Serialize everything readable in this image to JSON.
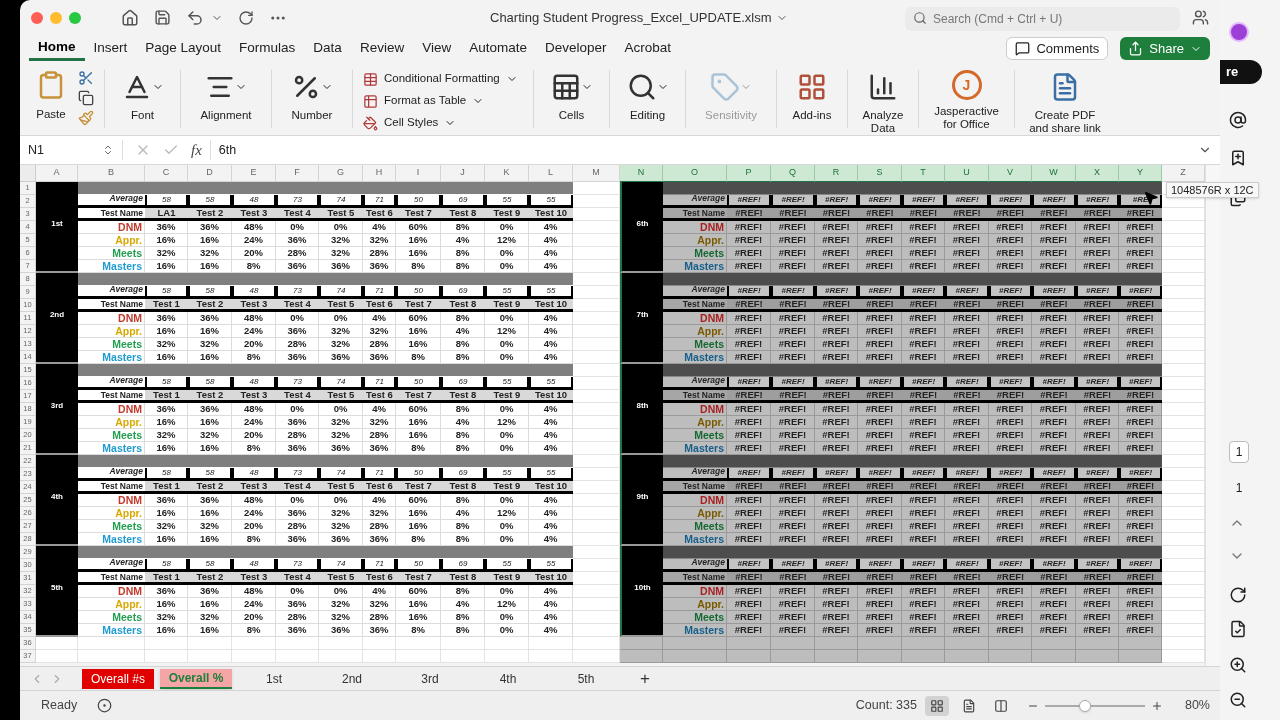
{
  "window": {
    "title": "Charting Student Progress_Excel_UPDATE.xlsm",
    "search_placeholder": "Search (Cmd + Ctrl + U)"
  },
  "tabs": [
    {
      "label": "Home",
      "selected": true
    },
    {
      "label": "Insert",
      "selected": false
    },
    {
      "label": "Page Layout",
      "selected": false
    },
    {
      "label": "Formulas",
      "selected": false
    },
    {
      "label": "Data",
      "selected": false
    },
    {
      "label": "Review",
      "selected": false
    },
    {
      "label": "View",
      "selected": false
    },
    {
      "label": "Automate",
      "selected": false
    },
    {
      "label": "Developer",
      "selected": false
    },
    {
      "label": "Acrobat",
      "selected": false
    }
  ],
  "comments_button": "Comments",
  "share_button": "Share",
  "ribbon": [
    {
      "kind": "paste",
      "label": "Paste",
      "disabled": false
    },
    {
      "kind": "font",
      "label": "Font",
      "disabled": false
    },
    {
      "kind": "alignment",
      "label": "Alignment",
      "disabled": false
    },
    {
      "kind": "number",
      "label": "Number",
      "disabled": false
    },
    {
      "kind": "styles",
      "items": [
        "Conditional Formatting",
        "Format as Table",
        "Cell Styles"
      ],
      "disabled": false
    },
    {
      "kind": "cells",
      "label": "Cells",
      "disabled": false
    },
    {
      "kind": "editing",
      "label": "Editing",
      "disabled": false
    },
    {
      "kind": "sensitivity",
      "label": "Sensitivity",
      "disabled": true
    },
    {
      "kind": "addins",
      "label": "Add-ins",
      "disabled": false
    },
    {
      "kind": "analyze",
      "label": "Analyze Data",
      "disabled": false
    },
    {
      "kind": "jasper",
      "label": "Jasperactive for Office",
      "logo": "J",
      "disabled": false
    },
    {
      "kind": "pdf",
      "label": "Create PDF and share link",
      "disabled": false
    }
  ],
  "formula_bar": {
    "name_box": "N1",
    "fx": "fx",
    "value": "6th"
  },
  "columns": [
    {
      "label": "A",
      "selected": false
    },
    {
      "label": "B",
      "selected": false
    },
    {
      "label": "C",
      "selected": false
    },
    {
      "label": "D",
      "selected": false
    },
    {
      "label": "E",
      "selected": false
    },
    {
      "label": "F",
      "selected": false
    },
    {
      "label": "G",
      "selected": false
    },
    {
      "label": "H",
      "selected": false
    },
    {
      "label": "I",
      "selected": false
    },
    {
      "label": "J",
      "selected": false
    },
    {
      "label": "K",
      "selected": false
    },
    {
      "label": "L",
      "selected": false
    },
    {
      "label": "M",
      "selected": false
    },
    {
      "label": "N",
      "selected": true
    },
    {
      "label": "O",
      "selected": true
    },
    {
      "label": "P",
      "selected": true
    },
    {
      "label": "Q",
      "selected": true
    },
    {
      "label": "R",
      "selected": true
    },
    {
      "label": "S",
      "selected": true
    },
    {
      "label": "T",
      "selected": true
    },
    {
      "label": "U",
      "selected": true
    },
    {
      "label": "V",
      "selected": true
    },
    {
      "label": "W",
      "selected": true
    },
    {
      "label": "X",
      "selected": true
    },
    {
      "label": "Y",
      "selected": true
    },
    {
      "label": "Z",
      "selected": false
    }
  ],
  "rows": [
    "1",
    "2",
    "3",
    "4",
    "5",
    "6",
    "7",
    "8",
    "9",
    "10",
    "11",
    "12",
    "13",
    "14",
    "15",
    "16",
    "17",
    "18",
    "19",
    "20",
    "21",
    "22",
    "23",
    "24",
    "25",
    "26",
    "27",
    "28",
    "29",
    "30",
    "31",
    "32",
    "33",
    "34",
    "35",
    "36",
    "37"
  ],
  "blocks": [
    {
      "label": "1st",
      "selected": false,
      "average_label": "Average",
      "test_label": "Test Name",
      "averages": [
        "58",
        "58",
        "48",
        "73",
        "74",
        "71",
        "50",
        "69",
        "55",
        "55"
      ],
      "tests": [
        "LA1",
        "Test 2",
        "Test 3",
        "Test 4",
        "Test 5",
        "Test 6",
        "Test 7",
        "Test 8",
        "Test 9",
        "Test 10"
      ],
      "categories": [
        {
          "name": "DNM",
          "color": "#c0392b",
          "values": [
            "36%",
            "36%",
            "48%",
            "0%",
            "0%",
            "4%",
            "60%",
            "8%",
            "0%",
            "4%"
          ]
        },
        {
          "name": "Appr.",
          "color": "#d9a800",
          "values": [
            "16%",
            "16%",
            "24%",
            "36%",
            "32%",
            "32%",
            "16%",
            "4%",
            "12%",
            "4%"
          ]
        },
        {
          "name": "Meets",
          "color": "#22a050",
          "values": [
            "32%",
            "32%",
            "20%",
            "28%",
            "32%",
            "28%",
            "16%",
            "8%",
            "0%",
            "4%"
          ]
        },
        {
          "name": "Masters",
          "color": "#1f9bd0",
          "values": [
            "16%",
            "16%",
            "8%",
            "36%",
            "36%",
            "36%",
            "8%",
            "8%",
            "0%",
            "4%"
          ]
        }
      ]
    },
    {
      "label": "2nd",
      "selected": false,
      "average_label": "Average",
      "test_label": "Test Name",
      "averages": [
        "58",
        "58",
        "48",
        "73",
        "74",
        "71",
        "50",
        "69",
        "55",
        "55"
      ],
      "tests": [
        "Test 1",
        "Test 2",
        "Test 3",
        "Test 4",
        "Test 5",
        "Test 6",
        "Test 7",
        "Test 8",
        "Test 9",
        "Test 10"
      ],
      "categories": [
        {
          "name": "DNM",
          "color": "#c0392b",
          "values": [
            "36%",
            "36%",
            "48%",
            "0%",
            "0%",
            "4%",
            "60%",
            "8%",
            "0%",
            "4%"
          ]
        },
        {
          "name": "Appr.",
          "color": "#d9a800",
          "values": [
            "16%",
            "16%",
            "24%",
            "36%",
            "32%",
            "32%",
            "16%",
            "4%",
            "12%",
            "4%"
          ]
        },
        {
          "name": "Meets",
          "color": "#22a050",
          "values": [
            "32%",
            "32%",
            "20%",
            "28%",
            "32%",
            "28%",
            "16%",
            "8%",
            "0%",
            "4%"
          ]
        },
        {
          "name": "Masters",
          "color": "#1f9bd0",
          "values": [
            "16%",
            "16%",
            "8%",
            "36%",
            "36%",
            "36%",
            "8%",
            "8%",
            "0%",
            "4%"
          ]
        }
      ]
    },
    {
      "label": "3rd",
      "selected": false,
      "average_label": "Average",
      "test_label": "Test Name",
      "averages": [
        "58",
        "58",
        "48",
        "73",
        "74",
        "71",
        "50",
        "69",
        "55",
        "55"
      ],
      "tests": [
        "Test 1",
        "Test 2",
        "Test 3",
        "Test 4",
        "Test 5",
        "Test 6",
        "Test 7",
        "Test 8",
        "Test 9",
        "Test 10"
      ],
      "categories": [
        {
          "name": "DNM",
          "color": "#c0392b",
          "values": [
            "36%",
            "36%",
            "48%",
            "0%",
            "0%",
            "4%",
            "60%",
            "8%",
            "0%",
            "4%"
          ]
        },
        {
          "name": "Appr.",
          "color": "#d9a800",
          "values": [
            "16%",
            "16%",
            "24%",
            "36%",
            "32%",
            "32%",
            "16%",
            "4%",
            "12%",
            "4%"
          ]
        },
        {
          "name": "Meets",
          "color": "#22a050",
          "values": [
            "32%",
            "32%",
            "20%",
            "28%",
            "32%",
            "28%",
            "16%",
            "8%",
            "0%",
            "4%"
          ]
        },
        {
          "name": "Masters",
          "color": "#1f9bd0",
          "values": [
            "16%",
            "16%",
            "8%",
            "36%",
            "36%",
            "36%",
            "8%",
            "8%",
            "0%",
            "4%"
          ]
        }
      ]
    },
    {
      "label": "4th",
      "selected": false,
      "average_label": "Average",
      "test_label": "Test Name",
      "averages": [
        "58",
        "58",
        "48",
        "73",
        "74",
        "71",
        "50",
        "69",
        "55",
        "55"
      ],
      "tests": [
        "Test 1",
        "Test 2",
        "Test 3",
        "Test 4",
        "Test 5",
        "Test 6",
        "Test 7",
        "Test 8",
        "Test 9",
        "Test 10"
      ],
      "categories": [
        {
          "name": "DNM",
          "color": "#c0392b",
          "values": [
            "36%",
            "36%",
            "48%",
            "0%",
            "0%",
            "4%",
            "60%",
            "8%",
            "0%",
            "4%"
          ]
        },
        {
          "name": "Appr.",
          "color": "#d9a800",
          "values": [
            "16%",
            "16%",
            "24%",
            "36%",
            "32%",
            "32%",
            "16%",
            "4%",
            "12%",
            "4%"
          ]
        },
        {
          "name": "Meets",
          "color": "#22a050",
          "values": [
            "32%",
            "32%",
            "20%",
            "28%",
            "32%",
            "28%",
            "16%",
            "8%",
            "0%",
            "4%"
          ]
        },
        {
          "name": "Masters",
          "color": "#1f9bd0",
          "values": [
            "16%",
            "16%",
            "8%",
            "36%",
            "36%",
            "36%",
            "8%",
            "8%",
            "0%",
            "4%"
          ]
        }
      ]
    },
    {
      "label": "5th",
      "selected": false,
      "average_label": "Average",
      "test_label": "Test Name",
      "averages": [
        "58",
        "58",
        "48",
        "73",
        "74",
        "71",
        "50",
        "69",
        "55",
        "55"
      ],
      "tests": [
        "Test 1",
        "Test 2",
        "Test 3",
        "Test 4",
        "Test 5",
        "Test 6",
        "Test 7",
        "Test 8",
        "Test 9",
        "Test 10"
      ],
      "categories": [
        {
          "name": "DNM",
          "color": "#c0392b",
          "values": [
            "36%",
            "36%",
            "48%",
            "0%",
            "0%",
            "4%",
            "60%",
            "8%",
            "0%",
            "4%"
          ]
        },
        {
          "name": "Appr.",
          "color": "#d9a800",
          "values": [
            "16%",
            "16%",
            "24%",
            "36%",
            "32%",
            "32%",
            "16%",
            "4%",
            "12%",
            "4%"
          ]
        },
        {
          "name": "Meets",
          "color": "#22a050",
          "values": [
            "32%",
            "32%",
            "20%",
            "28%",
            "32%",
            "28%",
            "16%",
            "8%",
            "0%",
            "4%"
          ]
        },
        {
          "name": "Masters",
          "color": "#1f9bd0",
          "values": [
            "16%",
            "16%",
            "8%",
            "36%",
            "36%",
            "36%",
            "8%",
            "8%",
            "0%",
            "4%"
          ]
        }
      ]
    },
    {
      "label": "6th",
      "selected": true,
      "average_label": "Average",
      "test_label": "Test Name",
      "averages": [
        "#REF!",
        "#REF!",
        "#REF!",
        "#REF!",
        "#REF!",
        "#REF!",
        "#REF!",
        "#REF!",
        "#REF!",
        "#RE"
      ],
      "tests": [
        "#REF!",
        "#REF!",
        "#REF!",
        "#REF!",
        "#REF!",
        "#REF!",
        "#REF!",
        "#REF!",
        "#REF!",
        "#REF!"
      ],
      "categories": [
        {
          "name": "DNM",
          "color": "#a82020",
          "values": [
            "#REF!",
            "#REF!",
            "#REF!",
            "#REF!",
            "#REF!",
            "#REF!",
            "#REF!",
            "#REF!",
            "#REF!",
            "#REF!"
          ]
        },
        {
          "name": "Appr.",
          "color": "#7a5a00",
          "values": [
            "#REF!",
            "#REF!",
            "#REF!",
            "#REF!",
            "#REF!",
            "#REF!",
            "#REF!",
            "#REF!",
            "#REF!",
            "#REF!"
          ]
        },
        {
          "name": "Meets",
          "color": "#146a32",
          "values": [
            "#REF!",
            "#REF!",
            "#REF!",
            "#REF!",
            "#REF!",
            "#REF!",
            "#REF!",
            "#REF!",
            "#REF!",
            "#REF!"
          ]
        },
        {
          "name": "Masters",
          "color": "#165f8c",
          "values": [
            "#REF!",
            "#REF!",
            "#REF!",
            "#REF!",
            "#REF!",
            "#REF!",
            "#REF!",
            "#REF!",
            "#REF!",
            "#REF!"
          ]
        }
      ]
    },
    {
      "label": "7th",
      "selected": true,
      "average_label": "Average",
      "test_label": "Test Name",
      "averages": [
        "#REF!",
        "#REF!",
        "#REF!",
        "#REF!",
        "#REF!",
        "#REF!",
        "#REF!",
        "#REF!",
        "#REF!",
        "#REF!"
      ],
      "tests": [
        "#REF!",
        "#REF!",
        "#REF!",
        "#REF!",
        "#REF!",
        "#REF!",
        "#REF!",
        "#REF!",
        "#REF!",
        "#REF!"
      ],
      "categories": [
        {
          "name": "DNM",
          "color": "#a82020",
          "values": [
            "#REF!",
            "#REF!",
            "#REF!",
            "#REF!",
            "#REF!",
            "#REF!",
            "#REF!",
            "#REF!",
            "#REF!",
            "#REF!"
          ]
        },
        {
          "name": "Appr.",
          "color": "#7a5a00",
          "values": [
            "#REF!",
            "#REF!",
            "#REF!",
            "#REF!",
            "#REF!",
            "#REF!",
            "#REF!",
            "#REF!",
            "#REF!",
            "#REF!"
          ]
        },
        {
          "name": "Meets",
          "color": "#146a32",
          "values": [
            "#REF!",
            "#REF!",
            "#REF!",
            "#REF!",
            "#REF!",
            "#REF!",
            "#REF!",
            "#REF!",
            "#REF!",
            "#REF!"
          ]
        },
        {
          "name": "Masters",
          "color": "#165f8c",
          "values": [
            "#REF!",
            "#REF!",
            "#REF!",
            "#REF!",
            "#REF!",
            "#REF!",
            "#REF!",
            "#REF!",
            "#REF!",
            "#REF!"
          ]
        }
      ]
    },
    {
      "label": "8th",
      "selected": true,
      "average_label": "Average",
      "test_label": "Test Name",
      "averages": [
        "#REF!",
        "#REF!",
        "#REF!",
        "#REF!",
        "#REF!",
        "#REF!",
        "#REF!",
        "#REF!",
        "#REF!",
        "#REF!"
      ],
      "tests": [
        "#REF!",
        "#REF!",
        "#REF!",
        "#REF!",
        "#REF!",
        "#REF!",
        "#REF!",
        "#REF!",
        "#REF!",
        "#REF!"
      ],
      "categories": [
        {
          "name": "DNM",
          "color": "#a82020",
          "values": [
            "#REF!",
            "#REF!",
            "#REF!",
            "#REF!",
            "#REF!",
            "#REF!",
            "#REF!",
            "#REF!",
            "#REF!",
            "#REF!"
          ]
        },
        {
          "name": "Appr.",
          "color": "#7a5a00",
          "values": [
            "#REF!",
            "#REF!",
            "#REF!",
            "#REF!",
            "#REF!",
            "#REF!",
            "#REF!",
            "#REF!",
            "#REF!",
            "#REF!"
          ]
        },
        {
          "name": "Meets",
          "color": "#146a32",
          "values": [
            "#REF!",
            "#REF!",
            "#REF!",
            "#REF!",
            "#REF!",
            "#REF!",
            "#REF!",
            "#REF!",
            "#REF!",
            "#REF!"
          ]
        },
        {
          "name": "Masters",
          "color": "#165f8c",
          "values": [
            "#REF!",
            "#REF!",
            "#REF!",
            "#REF!",
            "#REF!",
            "#REF!",
            "#REF!",
            "#REF!",
            "#REF!",
            "#REF!"
          ]
        }
      ]
    },
    {
      "label": "9th",
      "selected": true,
      "average_label": "Average",
      "test_label": "Test Name",
      "averages": [
        "#REF!",
        "#REF!",
        "#REF!",
        "#REF!",
        "#REF!",
        "#REF!",
        "#REF!",
        "#REF!",
        "#REF!",
        "#REF!"
      ],
      "tests": [
        "#REF!",
        "#REF!",
        "#REF!",
        "#REF!",
        "#REF!",
        "#REF!",
        "#REF!",
        "#REF!",
        "#REF!",
        "#REF!"
      ],
      "categories": [
        {
          "name": "DNM",
          "color": "#a82020",
          "values": [
            "#REF!",
            "#REF!",
            "#REF!",
            "#REF!",
            "#REF!",
            "#REF!",
            "#REF!",
            "#REF!",
            "#REF!",
            "#REF!"
          ]
        },
        {
          "name": "Appr.",
          "color": "#7a5a00",
          "values": [
            "#REF!",
            "#REF!",
            "#REF!",
            "#REF!",
            "#REF!",
            "#REF!",
            "#REF!",
            "#REF!",
            "#REF!",
            "#REF!"
          ]
        },
        {
          "name": "Meets",
          "color": "#146a32",
          "values": [
            "#REF!",
            "#REF!",
            "#REF!",
            "#REF!",
            "#REF!",
            "#REF!",
            "#REF!",
            "#REF!",
            "#REF!",
            "#REF!"
          ]
        },
        {
          "name": "Masters",
          "color": "#165f8c",
          "values": [
            "#REF!",
            "#REF!",
            "#REF!",
            "#REF!",
            "#REF!",
            "#REF!",
            "#REF!",
            "#REF!",
            "#REF!",
            "#REF!"
          ]
        }
      ]
    },
    {
      "label": "10th",
      "selected": true,
      "average_label": "Average",
      "test_label": "Test Name",
      "averages": [
        "#REF!",
        "#REF!",
        "#REF!",
        "#REF!",
        "#REF!",
        "#REF!",
        "#REF!",
        "#REF!",
        "#REF!",
        "#REF!"
      ],
      "tests": [
        "#REF!",
        "#REF!",
        "#REF!",
        "#REF!",
        "#REF!",
        "#REF!",
        "#REF!",
        "#REF!",
        "#REF!",
        "#REF!"
      ],
      "categories": [
        {
          "name": "DNM",
          "color": "#a82020",
          "values": [
            "#REF!",
            "#REF!",
            "#REF!",
            "#REF!",
            "#REF!",
            "#REF!",
            "#REF!",
            "#REF!",
            "#REF!",
            "#REF!"
          ]
        },
        {
          "name": "Appr.",
          "color": "#7a5a00",
          "values": [
            "#REF!",
            "#REF!",
            "#REF!",
            "#REF!",
            "#REF!",
            "#REF!",
            "#REF!",
            "#REF!",
            "#REF!",
            "#REF!"
          ]
        },
        {
          "name": "Meets",
          "color": "#146a32",
          "values": [
            "#REF!",
            "#REF!",
            "#REF!",
            "#REF!",
            "#REF!",
            "#REF!",
            "#REF!",
            "#REF!",
            "#REF!",
            "#REF!"
          ]
        },
        {
          "name": "Masters",
          "color": "#165f8c",
          "values": [
            "#REF!",
            "#REF!",
            "#REF!",
            "#REF!",
            "#REF!",
            "#REF!",
            "#REF!",
            "#REF!",
            "#REF!",
            "#REF!"
          ]
        }
      ]
    }
  ],
  "selection_tooltip": "1048576R x 12C",
  "sheet_tabs": [
    {
      "label": "Overall #s",
      "selected": false,
      "color": "#e00000"
    },
    {
      "label": "Overall %",
      "selected": true,
      "color": "#f4a6a6"
    },
    {
      "label": "1st",
      "selected": false
    },
    {
      "label": "2nd",
      "selected": false
    },
    {
      "label": "3rd",
      "selected": false
    },
    {
      "label": "4th",
      "selected": false
    },
    {
      "label": "5th",
      "selected": false
    }
  ],
  "add_sheet": "+",
  "status_bar": {
    "ready": "Ready",
    "count": "Count: 335",
    "views": [
      {
        "kind": "normal",
        "selected": true
      },
      {
        "kind": "page_layout",
        "selected": false
      },
      {
        "kind": "page_break",
        "selected": false
      }
    ],
    "zoom": {
      "level": 0.4,
      "reading": "80%"
    }
  },
  "side_panel": {
    "pill": "re",
    "pages": [
      {
        "label": "1",
        "selected": true
      },
      {
        "label": "1",
        "selected": false
      }
    ]
  }
}
